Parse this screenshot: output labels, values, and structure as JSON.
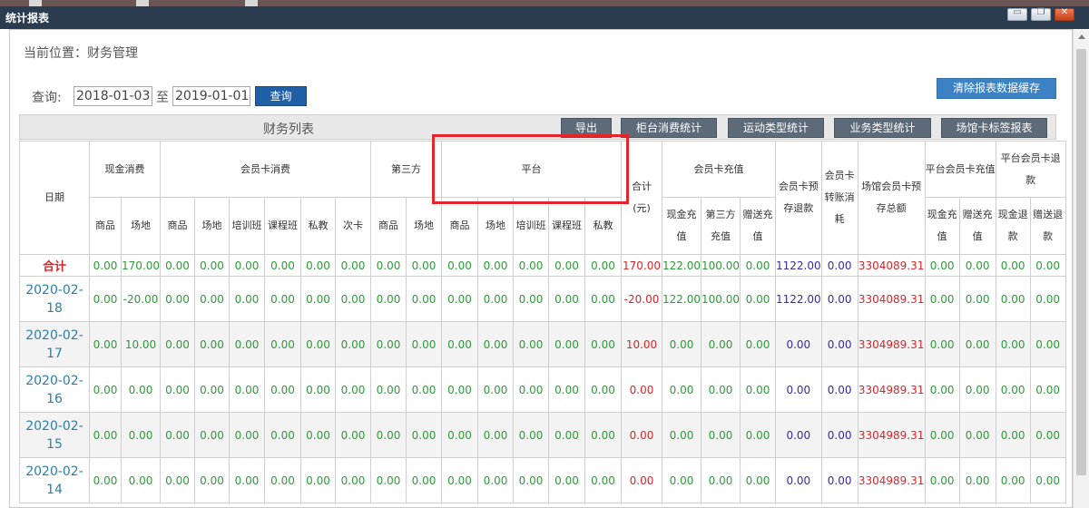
{
  "window": {
    "title": "统计报表",
    "min_glyph": "▭",
    "max_glyph": "❐",
    "close_glyph": "✕"
  },
  "breadcrumb": "当前位置：财务管理",
  "query": {
    "label": "查询:",
    "start_date": "2018-01-03",
    "to_label": "至",
    "end_date": "2019-01-01",
    "button": "查询"
  },
  "clear_cache_button": "清除报表数据缓存",
  "table_title": "财务列表",
  "toolbar": {
    "export": "导出",
    "counter": "柜台消费统计",
    "sports": "运动类型统计",
    "business": "业务类型统计",
    "tags": "场馆卡标签报表"
  },
  "headers": {
    "date": "日期",
    "cash": "现金消费",
    "member": "会员卡消费",
    "third": "第三方",
    "platform": "平台",
    "total": "合计\n(元)",
    "recharge": "会员卡充值",
    "refund": "会员卡预存退款",
    "transfer": "会员卡转账消耗",
    "venue": "场馆会员卡预存总额",
    "plat_recharge": "平台会员卡充值",
    "plat_refund": "平台会员卡退款",
    "sub": {
      "goods": "商品",
      "venue": "场地",
      "training": "培训班",
      "course": "课程班",
      "private": "私教",
      "times": "次卡",
      "cash_recharge": "现金充值",
      "third_recharge": "第三方充值",
      "gift_recharge": "赠送充值",
      "cash_r": "现金充值",
      "gift_r": "赠送充值",
      "cash_ref": "现金退款",
      "gift_ref": "赠送退款"
    }
  },
  "rows": [
    {
      "date": "合计",
      "is_total": true,
      "v": [
        "0.00",
        "170.00",
        "0.00",
        "0.00",
        "0.00",
        "0.00",
        "0.00",
        "0.00",
        "0.00",
        "0.00",
        "0.00",
        "0.00",
        "0.00",
        "0.00",
        "0.00",
        "170.00",
        "122.00",
        "100.00",
        "0.00",
        "1122.00",
        "0.00",
        "3304089.31",
        "0.00",
        "0.00",
        "0.00",
        "0.00"
      ]
    },
    {
      "date": "2020-02-18",
      "v": [
        "0.00",
        "-20.00",
        "0.00",
        "0.00",
        "0.00",
        "0.00",
        "0.00",
        "0.00",
        "0.00",
        "0.00",
        "0.00",
        "0.00",
        "0.00",
        "0.00",
        "0.00",
        "-20.00",
        "122.00",
        "100.00",
        "0.00",
        "1122.00",
        "0.00",
        "3304089.31",
        "0.00",
        "0.00",
        "0.00",
        "0.00"
      ]
    },
    {
      "date": "2020-02-17",
      "v": [
        "0.00",
        "10.00",
        "0.00",
        "0.00",
        "0.00",
        "0.00",
        "0.00",
        "0.00",
        "0.00",
        "0.00",
        "0.00",
        "0.00",
        "0.00",
        "0.00",
        "0.00",
        "10.00",
        "0.00",
        "0.00",
        "0.00",
        "0.00",
        "0.00",
        "3304989.31",
        "0.00",
        "0.00",
        "0.00",
        "0.00"
      ]
    },
    {
      "date": "2020-02-16",
      "v": [
        "0.00",
        "0.00",
        "0.00",
        "0.00",
        "0.00",
        "0.00",
        "0.00",
        "0.00",
        "0.00",
        "0.00",
        "0.00",
        "0.00",
        "0.00",
        "0.00",
        "0.00",
        "0.00",
        "0.00",
        "0.00",
        "0.00",
        "0.00",
        "0.00",
        "3304989.31",
        "0.00",
        "0.00",
        "0.00",
        "0.00"
      ]
    },
    {
      "date": "2020-02-15",
      "v": [
        "0.00",
        "0.00",
        "0.00",
        "0.00",
        "0.00",
        "0.00",
        "0.00",
        "0.00",
        "0.00",
        "0.00",
        "0.00",
        "0.00",
        "0.00",
        "0.00",
        "0.00",
        "0.00",
        "0.00",
        "0.00",
        "0.00",
        "0.00",
        "0.00",
        "3304989.31",
        "0.00",
        "0.00",
        "0.00",
        "0.00"
      ]
    },
    {
      "date": "2020-02-14",
      "v": [
        "0.00",
        "0.00",
        "0.00",
        "0.00",
        "0.00",
        "0.00",
        "0.00",
        "0.00",
        "0.00",
        "0.00",
        "0.00",
        "0.00",
        "0.00",
        "0.00",
        "0.00",
        "0.00",
        "0.00",
        "0.00",
        "0.00",
        "0.00",
        "0.00",
        "3304989.31",
        "0.00",
        "0.00",
        "0.00",
        "0.00"
      ]
    }
  ],
  "colors": {
    "green": "#2e9a3a",
    "red": "#d9242a",
    "purple": "#3a2aa5",
    "date_blue": "#2c7fa6",
    "highlight": "#e2262b"
  }
}
